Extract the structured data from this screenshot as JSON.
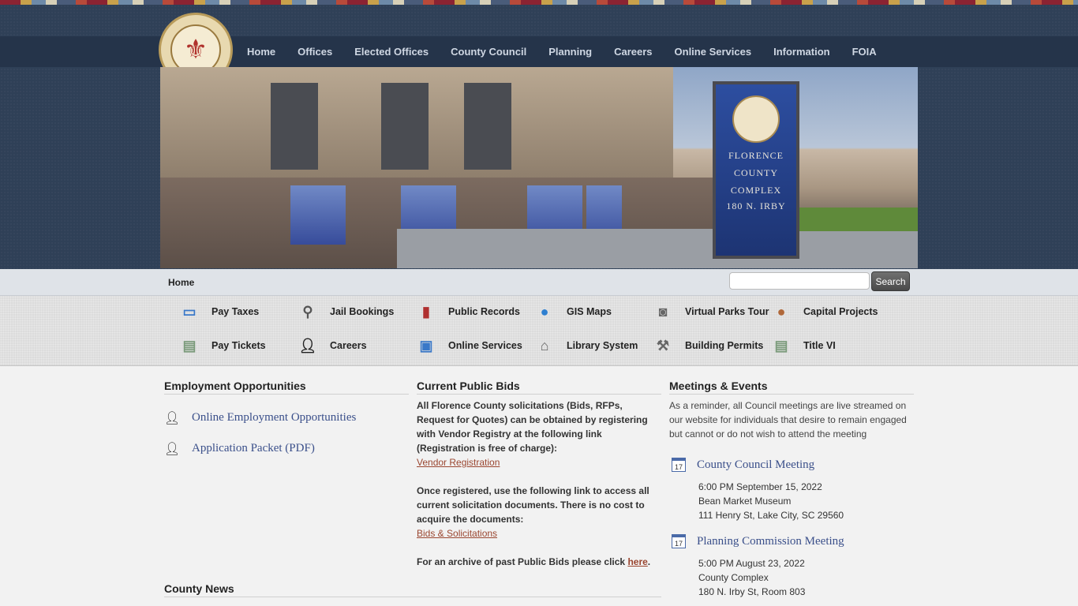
{
  "nav": {
    "items": [
      "Home",
      "Offices",
      "Elected Offices",
      "County Council",
      "Planning",
      "Careers",
      "Online Services",
      "Information",
      "FOIA"
    ]
  },
  "hero": {
    "sign_lines": [
      "FLORENCE",
      "COUNTY",
      "COMPLEX",
      "180 N. IRBY"
    ]
  },
  "breadcrumb": "Home",
  "search": {
    "button": "Search",
    "value": ""
  },
  "quicklinks": [
    {
      "label": "Pay Taxes",
      "icon": "credit-card-icon"
    },
    {
      "label": "Jail Bookings",
      "icon": "magnifier-icon"
    },
    {
      "label": "Public Records",
      "icon": "books-icon"
    },
    {
      "label": "GIS Maps",
      "icon": "globe-icon"
    },
    {
      "label": "Virtual Parks Tour",
      "icon": "camera-icon"
    },
    {
      "label": "Capital Projects",
      "icon": "coin-icon"
    },
    {
      "label": "Pay Tickets",
      "icon": "document-icon"
    },
    {
      "label": "Careers",
      "icon": "person-icon"
    },
    {
      "label": "Online Services",
      "icon": "computer-icon"
    },
    {
      "label": "Library System",
      "icon": "building-icon"
    },
    {
      "label": "Building Permits",
      "icon": "hammer-icon"
    },
    {
      "label": "Title VI",
      "icon": "document-icon"
    }
  ],
  "employment": {
    "heading": "Employment Opportunities",
    "links": [
      "Online Employment Opportunities",
      "Application Packet (PDF)"
    ]
  },
  "bids": {
    "heading": "Current Public Bids",
    "p1": "All Florence County solicitations (Bids, RFPs, Request for Quotes) can be obtained by registering with Vendor Registry at the following link (Registration is free of charge):",
    "link1": "Vendor Registration",
    "p2": "Once registered, use the following link to access all current solicitation documents. There is no cost to acquire the documents:",
    "link2": "Bids & Solicitations",
    "p3": "For an archive of past Public Bids please click",
    "link3": "here",
    "p3end": "."
  },
  "meetings": {
    "heading": "Meetings & Events",
    "intro": "As a reminder, all Council meetings are live streamed on our website for individuals that desire to remain engaged but cannot or do not wish to attend the meeting",
    "events": [
      {
        "title": "County Council Meeting",
        "day": "17",
        "lines": [
          "6:00 PM September 15, 2022",
          "Bean Market Museum",
          "111 Henry St, Lake City, SC 29560"
        ]
      },
      {
        "title": "Planning Commission Meeting",
        "day": "17",
        "lines": [
          "5:00 PM August 23, 2022",
          "County Complex",
          "180 N. Irby St, Room 803"
        ]
      }
    ]
  },
  "news": {
    "heading": "County News"
  }
}
